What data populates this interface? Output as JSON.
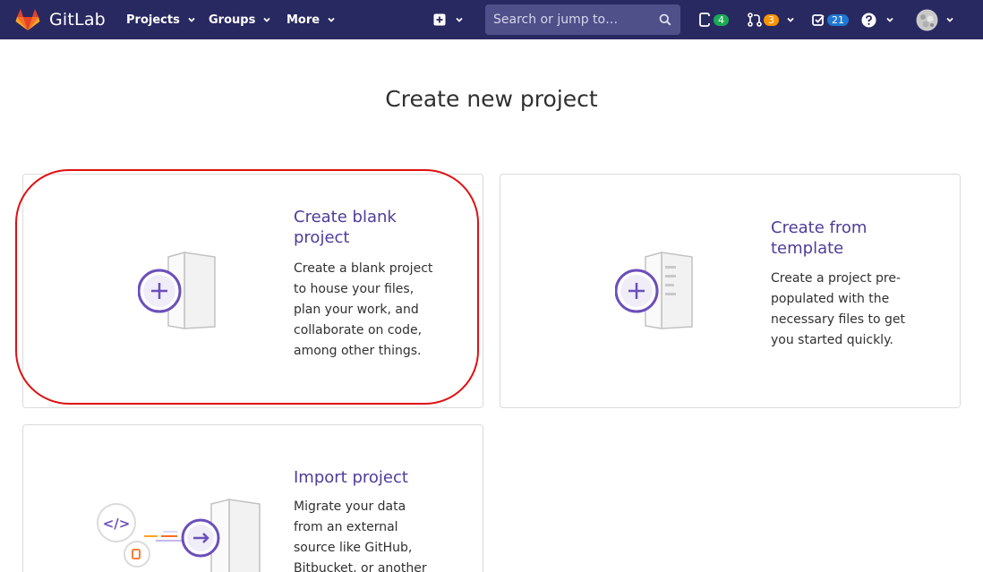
{
  "navbar": {
    "brand": "GitLab",
    "menus": [
      {
        "label": "Projects"
      },
      {
        "label": "Groups"
      },
      {
        "label": "More"
      }
    ],
    "search_placeholder": "Search or jump to…",
    "issues_count": "4",
    "merge_requests_count": "3",
    "todos_count": "21",
    "colors": {
      "bar": "#292961",
      "issues_badge": "#1aaa55",
      "mr_badge": "#fc9403",
      "todos_badge": "#1f78d1"
    }
  },
  "page": {
    "title": "Create new project"
  },
  "cards": {
    "blank": {
      "title": "Create blank project",
      "description": "Create a blank project to house your files, plan your work, and collaborate on code, among other things."
    },
    "template": {
      "title": "Create from template",
      "description": "Create a project pre-populated with the necessary files to get you started quickly."
    },
    "import": {
      "title": "Import project",
      "description": "Migrate your data from an external source like GitHub, Bitbucket, or another instance of"
    }
  }
}
